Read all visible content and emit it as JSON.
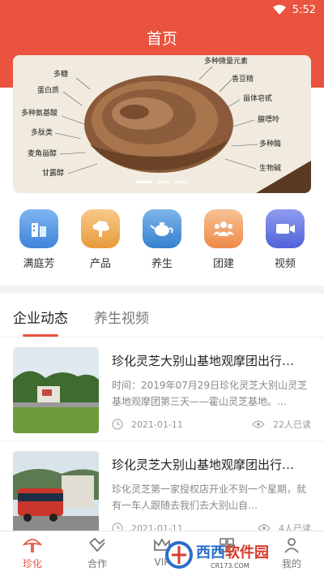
{
  "status_bar": {
    "time": "5:52"
  },
  "header": {
    "title": "首页"
  },
  "banner": {
    "left_labels": [
      "多糖",
      "蛋白质",
      "多种氨基酸",
      "多肽类",
      "麦角甾醇",
      "甘露醇"
    ],
    "right_labels": [
      "多种微量元素",
      "香豆精",
      "甾体皂甙",
      "腺嘌呤",
      "多种酶",
      "生物碱"
    ],
    "slide_count": 3,
    "active_slide": 1
  },
  "quick_links": [
    {
      "label": "满庭芳",
      "icon": "building-icon",
      "color": "#4a90e2"
    },
    {
      "label": "产品",
      "icon": "cloud-icon",
      "color": "#f0a23c"
    },
    {
      "label": "养生",
      "icon": "teapot-icon",
      "color": "#3d8ad6"
    },
    {
      "label": "团建",
      "icon": "group-icon",
      "color": "#f29b52"
    },
    {
      "label": "视频",
      "icon": "video-icon",
      "color": "#5b6de0"
    }
  ],
  "tabs": [
    {
      "label": "企业动态",
      "active": true
    },
    {
      "label": "养生视频",
      "active": false
    }
  ],
  "news": [
    {
      "title": "珍化灵芝大别山基地观摩团出行…",
      "summary": "时间：2019年07月29日珍化灵芝大别山灵芝基地观摩团第三天——霍山灵芝基地。…",
      "date": "2021-01-11",
      "views": "22人已读"
    },
    {
      "title": "珍化灵芝大别山基地观摩团出行…",
      "summary": "珍化灵芝第一家授权店开业不到一个星期，就有一车人跟随去我们去大别山自…",
      "date": "2021-01-11",
      "views": "4人已读"
    }
  ],
  "bottom_nav": [
    {
      "label": "珍化",
      "active": true
    },
    {
      "label": "合作",
      "active": false
    },
    {
      "label": "VIP",
      "active": false
    },
    {
      "label": "",
      "active": false
    },
    {
      "label": "我的",
      "active": false
    }
  ],
  "watermark": {
    "text_blue": "西西",
    "text_red": "软件园",
    "url": "CR173.COM"
  },
  "colors": {
    "accent": "#e9533f",
    "nav_active": "#e9533f"
  }
}
